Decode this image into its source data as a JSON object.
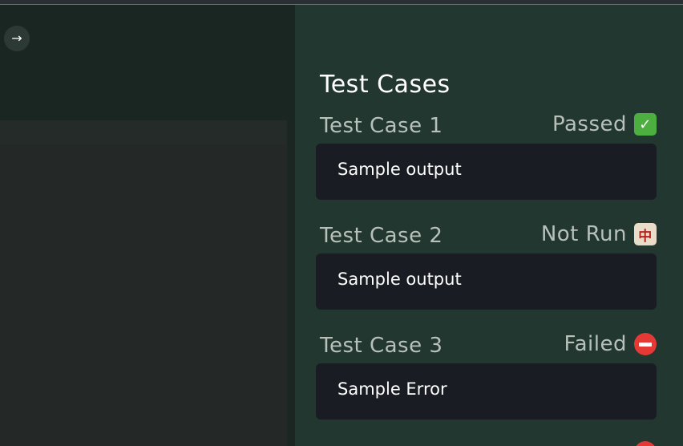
{
  "left_panel": {
    "arrow_icon": "→"
  },
  "right_panel": {
    "title": "Test Cases",
    "cases": [
      {
        "name": "Test Case 1",
        "status": "Passed",
        "status_icon": "✓",
        "icon_name": "check-mark-icon",
        "status_color": "#4caf3f",
        "output": "Sample output"
      },
      {
        "name": "Test Case 2",
        "status": "Not Run",
        "status_icon": "中",
        "icon_name": "mahjong-tile-icon",
        "status_color": "#e9dcc8",
        "output": "Sample output"
      },
      {
        "name": "Test Case 3",
        "status": "Failed",
        "status_icon": "",
        "icon_name": "no-entry-icon",
        "status_color": "#e53935",
        "output": "Sample Error"
      }
    ]
  },
  "colors": {
    "panel_background": "#22372f",
    "output_background": "#191c22",
    "left_background": "#1a2622"
  }
}
